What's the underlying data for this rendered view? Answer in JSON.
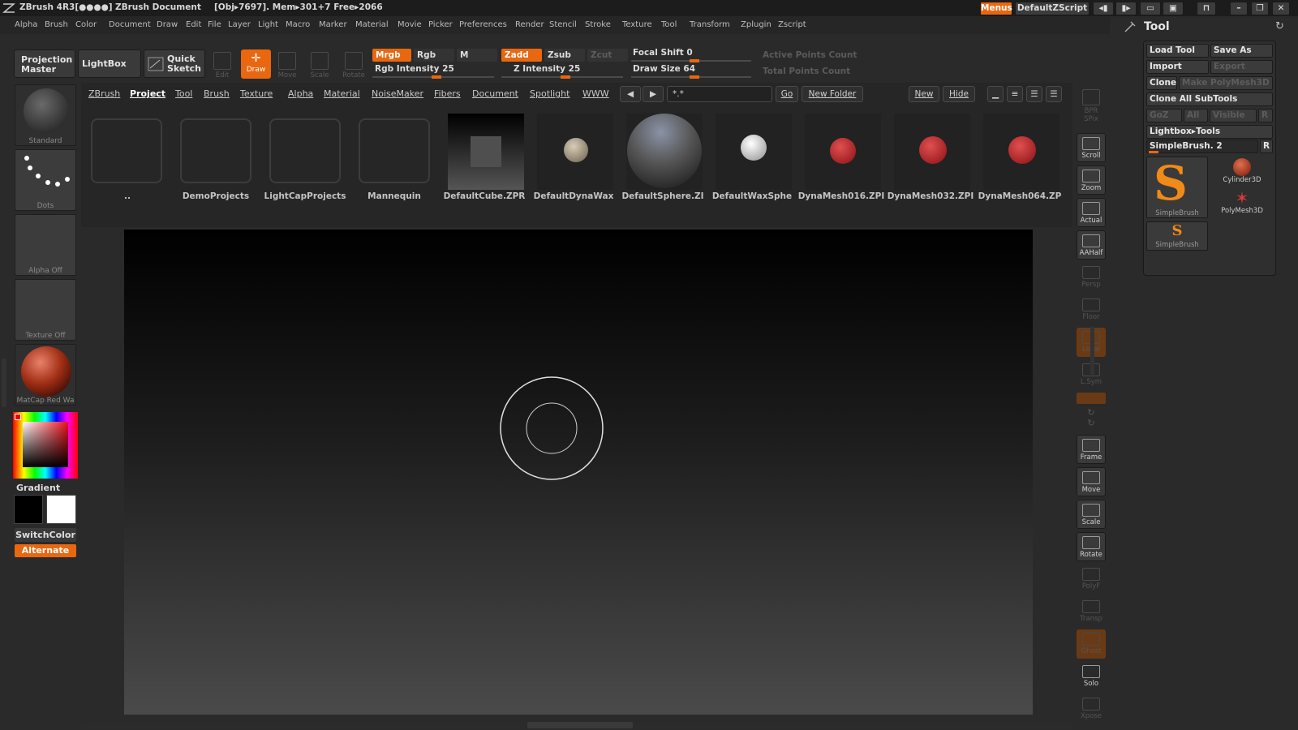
{
  "titlebar": {
    "app": "ZBrush 4R3[●●●●]",
    "document": "ZBrush Document",
    "stats": "[Obj▸7697]. Mem▸301+7  Free▸2066",
    "menus_btn": "Menus",
    "script_btn": "DefaultZScript"
  },
  "menubar": {
    "items": [
      "Alpha",
      "Brush",
      "Color",
      "Document",
      "Draw",
      "Edit",
      "File",
      "Layer",
      "Light",
      "Macro",
      "Marker",
      "Material",
      "Movie",
      "Picker",
      "Preferences",
      "Render",
      "Stencil",
      "Stroke",
      "Texture",
      "Tool",
      "Transform",
      "Zplugin",
      "Zscript"
    ]
  },
  "shelf": {
    "projection_master": [
      "Projection",
      "Master"
    ],
    "lightbox": "LightBox",
    "quick_sketch": [
      "Quick",
      "Sketch"
    ],
    "edit": "Edit",
    "draw": "Draw",
    "move": "Move",
    "scale": "Scale",
    "rotate": "Rotate",
    "mrgb": "Mrgb",
    "rgb": "Rgb",
    "m": "M",
    "zadd": "Zadd",
    "zsub": "Zsub",
    "zcut": "Zcut",
    "rgb_intensity": "Rgb Intensity 25",
    "z_intensity": "Z Intensity 25",
    "focal_shift": "Focal Shift 0",
    "draw_size": "Draw Size 64",
    "active_points": "Active Points Count",
    "total_points": "Total Points Count"
  },
  "left": {
    "brush_label": "Standard",
    "stroke_label": "Dots",
    "alpha_label": "Alpha  Off",
    "texture_label": "Texture  Off",
    "material_label": "MatCap Red Wa",
    "gradient": "Gradient",
    "switchcolor": "SwitchColor",
    "alternate": "Alternate"
  },
  "lightbox": {
    "tabs": [
      "ZBrush",
      "Project",
      "Tool",
      "Brush",
      "Texture",
      "Alpha",
      "Material",
      "NoiseMaker",
      "Fibers",
      "Document",
      "Spotlight",
      "WWW"
    ],
    "filter": "*.*",
    "go": "Go",
    "new_folder": "New Folder",
    "new": "New",
    "hide": "Hide",
    "items": [
      "..",
      "DemoProjects",
      "LightCapProjects",
      "Mannequin",
      "DefaultCube.ZPR",
      "DefaultDynaWax",
      "DefaultSphere.ZI",
      "DefaultWaxSphe",
      "DynaMesh016.ZPI",
      "DynaMesh032.ZPI",
      "DynaMesh064.ZP"
    ]
  },
  "rtool": {
    "buttons": [
      "BPR",
      "SPix",
      "Scroll",
      "Zoom",
      "Actual",
      "AAHalf",
      "Persp",
      "Floor",
      "Local",
      "L.Sym",
      "Frame",
      "Move",
      "Scale",
      "Rotate",
      "PolyF",
      "Transp",
      "Ghost",
      "Solo",
      "Xpose"
    ]
  },
  "toolpanel": {
    "title": "Tool",
    "load_tool": "Load Tool",
    "save_as": "Save As",
    "import": "Import",
    "export": "Export",
    "clone": "Clone",
    "make_polymesh": "Make PolyMesh3D",
    "clone_all": "Clone  All  SubTools",
    "goz": "GoZ",
    "all": "All",
    "visible": "Visible",
    "r": "R",
    "lightbox_tools": "Lightbox▸Tools",
    "current_tool": "SimpleBrush. 2",
    "thumb_main": "SimpleBrush",
    "thumb_cyl": "Cylinder3D",
    "thumb_poly": "PolyMesh3D",
    "thumb_small": "SimpleBrush"
  }
}
